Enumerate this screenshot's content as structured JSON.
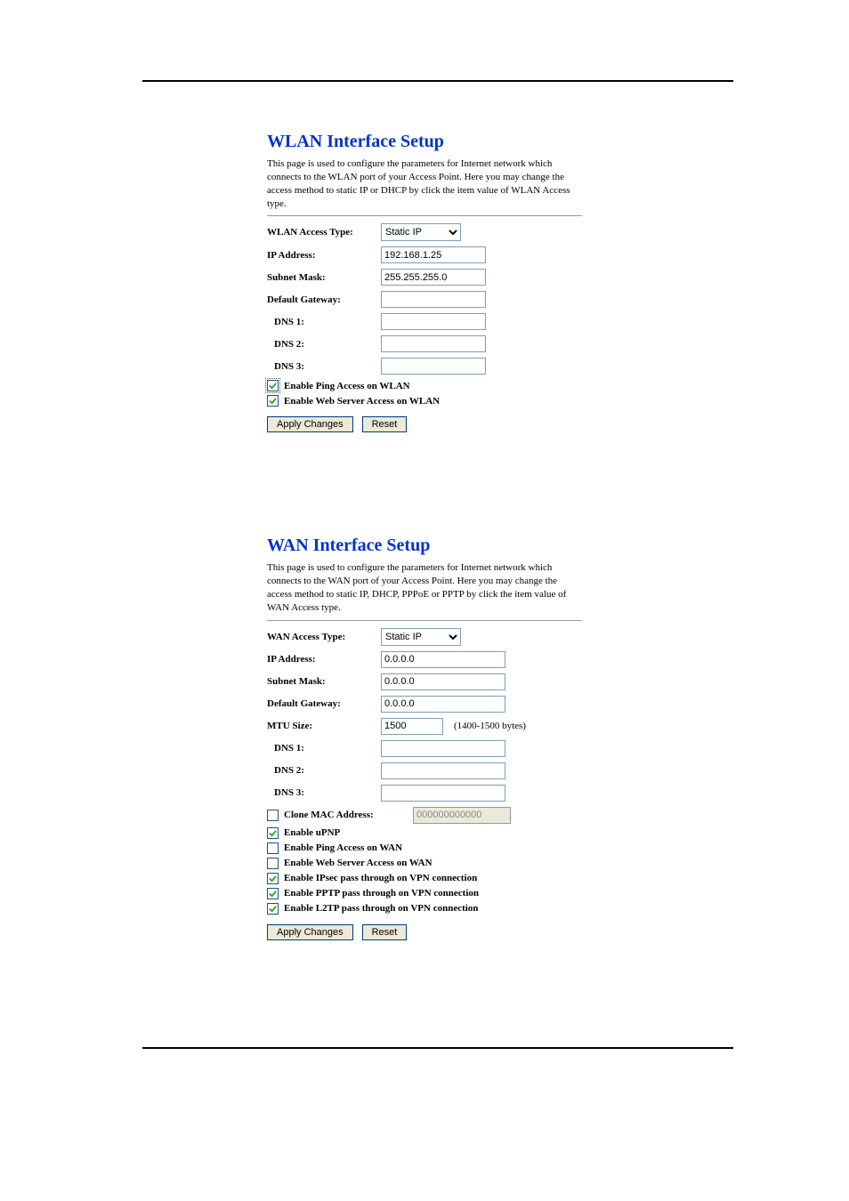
{
  "wlan": {
    "heading": "WLAN Interface Setup",
    "description": "This page is used to configure the parameters for Internet network which connects to the WLAN port of your Access Point. Here you may change the access method to static IP or DHCP by click the item value of WLAN Access type.",
    "labels": {
      "access_type": "WLAN Access Type:",
      "ip_address": "IP Address:",
      "subnet_mask": "Subnet Mask:",
      "default_gateway": "Default Gateway:",
      "dns1": "DNS 1:",
      "dns2": "DNS 2:",
      "dns3": "DNS 3:"
    },
    "values": {
      "access_type_selected": "Static IP",
      "ip_address": "192.168.1.25",
      "subnet_mask": "255.255.255.0",
      "default_gateway": "",
      "dns1": "",
      "dns2": "",
      "dns3": ""
    },
    "checkboxes": {
      "ping": {
        "label": "Enable Ping Access on WLAN",
        "checked": true
      },
      "webserver": {
        "label": "Enable Web Server Access on WLAN",
        "checked": true
      }
    },
    "buttons": {
      "apply": "Apply Changes",
      "reset": "Reset"
    }
  },
  "wan": {
    "heading": "WAN Interface Setup",
    "description": "This page is used to configure the parameters for Internet network which connects to the WAN port of your Access Point. Here you may change the access method to static IP, DHCP, PPPoE or PPTP by click the item value of WAN Access type.",
    "labels": {
      "access_type": "WAN Access Type:",
      "ip_address": "IP Address:",
      "subnet_mask": "Subnet Mask:",
      "default_gateway": "Default Gateway:",
      "mtu_size": "MTU Size:",
      "dns1": "DNS 1:",
      "dns2": "DNS 2:",
      "dns3": "DNS 3:",
      "clone_mac": "Clone MAC Address:"
    },
    "values": {
      "access_type_selected": "Static IP",
      "ip_address": "0.0.0.0",
      "subnet_mask": "0.0.0.0",
      "default_gateway": "0.0.0.0",
      "mtu_size": "1500",
      "mtu_hint": "(1400-1500 bytes)",
      "dns1": "",
      "dns2": "",
      "dns3": "",
      "clone_mac": "000000000000"
    },
    "checkboxes": {
      "clone_mac": {
        "checked": false
      },
      "upnp": {
        "label": "Enable uPNP",
        "checked": true
      },
      "ping": {
        "label": "Enable Ping Access on WAN",
        "checked": false
      },
      "webserver": {
        "label": "Enable Web Server Access on WAN",
        "checked": false
      },
      "ipsec": {
        "label": "Enable IPsec pass through on VPN connection",
        "checked": true
      },
      "pptp": {
        "label": "Enable PPTP pass through on VPN connection",
        "checked": true
      },
      "l2tp": {
        "label": "Enable L2TP pass through on VPN connection",
        "checked": true
      }
    },
    "buttons": {
      "apply": "Apply Changes",
      "reset": "Reset"
    }
  }
}
